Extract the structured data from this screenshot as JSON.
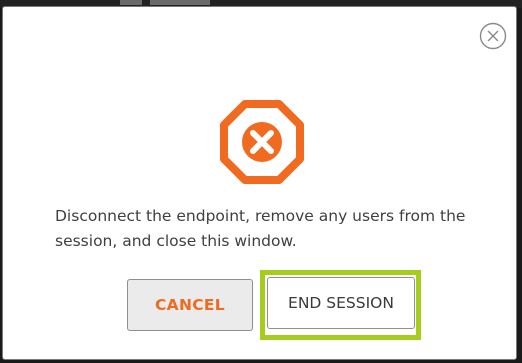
{
  "dialog": {
    "close_icon": "close-circle-icon",
    "warning_icon": "octagon-x-icon",
    "message": "Disconnect the endpoint, remove any users from the session, and close this window.",
    "buttons": {
      "cancel_label": "CANCEL",
      "end_session_label": "END SESSION"
    }
  },
  "colors": {
    "accent_orange": "#f06a1f",
    "focus_green": "#a6cc1e",
    "text": "#404040",
    "cancel_bg": "#ebebeb"
  }
}
